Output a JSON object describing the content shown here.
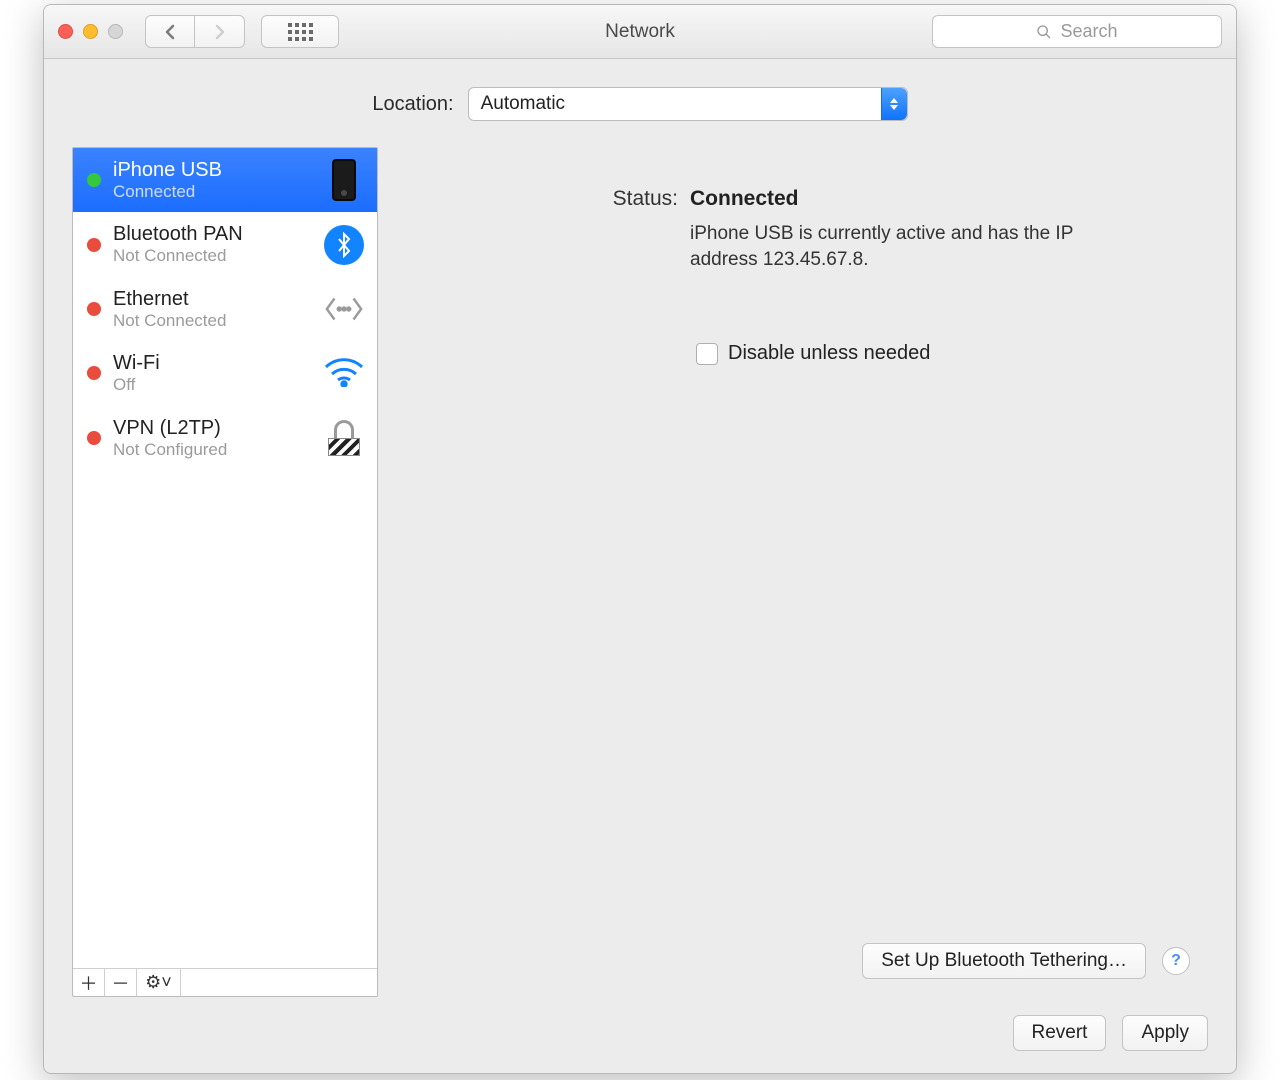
{
  "window": {
    "title": "Network"
  },
  "search": {
    "placeholder": "Search"
  },
  "location": {
    "label": "Location:",
    "value": "Automatic"
  },
  "services": [
    {
      "name": "iPhone USB",
      "status": "Connected",
      "dot": "green",
      "icon": "iphone",
      "selected": true
    },
    {
      "name": "Bluetooth PAN",
      "status": "Not Connected",
      "dot": "red",
      "icon": "bluetooth",
      "selected": false
    },
    {
      "name": "Ethernet",
      "status": "Not Connected",
      "dot": "red",
      "icon": "ethernet",
      "selected": false
    },
    {
      "name": "Wi-Fi",
      "status": "Off",
      "dot": "red",
      "icon": "wifi",
      "selected": false
    },
    {
      "name": "VPN (L2TP)",
      "status": "Not Configured",
      "dot": "red",
      "icon": "vpn-lock",
      "selected": false
    }
  ],
  "sidebar_footer": {
    "add": "＋",
    "remove": "－",
    "gear": "⚙︎˅"
  },
  "detail": {
    "status_label": "Status:",
    "status_value": "Connected",
    "status_desc": "iPhone USB is currently active and has the IP address 123.45.67.8.",
    "checkbox_label": "Disable unless needed",
    "advanced_button": "Set Up Bluetooth Tethering…",
    "help": "?"
  },
  "footer": {
    "revert": "Revert",
    "apply": "Apply"
  }
}
